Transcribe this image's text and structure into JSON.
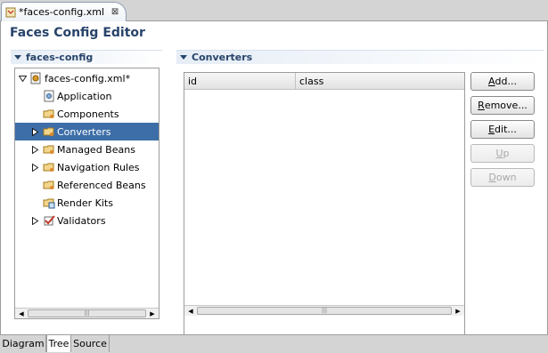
{
  "editor_tab": {
    "label": "*faces-config.xml",
    "close": "⊠"
  },
  "editor": {
    "title": "Faces Config Editor"
  },
  "left_section": {
    "title": "faces-config"
  },
  "right_section": {
    "title": "Converters"
  },
  "tree": {
    "root": {
      "label": "faces-config.xml*"
    },
    "items": [
      {
        "label": "Application",
        "expandable": false
      },
      {
        "label": "Components",
        "expandable": false
      },
      {
        "label": "Converters",
        "expandable": true,
        "selected": true
      },
      {
        "label": "Managed Beans",
        "expandable": true
      },
      {
        "label": "Navigation Rules",
        "expandable": true
      },
      {
        "label": "Referenced Beans",
        "expandable": false
      },
      {
        "label": "Render Kits",
        "expandable": false
      },
      {
        "label": "Validators",
        "expandable": true
      }
    ]
  },
  "table": {
    "columns": [
      "id",
      "class"
    ],
    "rows": []
  },
  "buttons": {
    "add": {
      "mnemonic": "A",
      "rest": "dd..."
    },
    "remove": {
      "mnemonic": "R",
      "rest": "emove..."
    },
    "edit": {
      "mnemonic": "E",
      "rest": "dit..."
    },
    "up": {
      "mnemonic": "U",
      "rest": "p"
    },
    "down": {
      "mnemonic": "D",
      "rest": "own"
    }
  },
  "bottom_tabs": [
    {
      "label": "Diagram",
      "active": false
    },
    {
      "label": "Tree",
      "active": true
    },
    {
      "label": "Source",
      "active": false
    }
  ],
  "scrollbar": {
    "left_arrow": "◀",
    "right_arrow": "▶",
    "grip": "|||"
  },
  "colors": {
    "title": "#27436a",
    "selection": "#3d6ea8"
  }
}
